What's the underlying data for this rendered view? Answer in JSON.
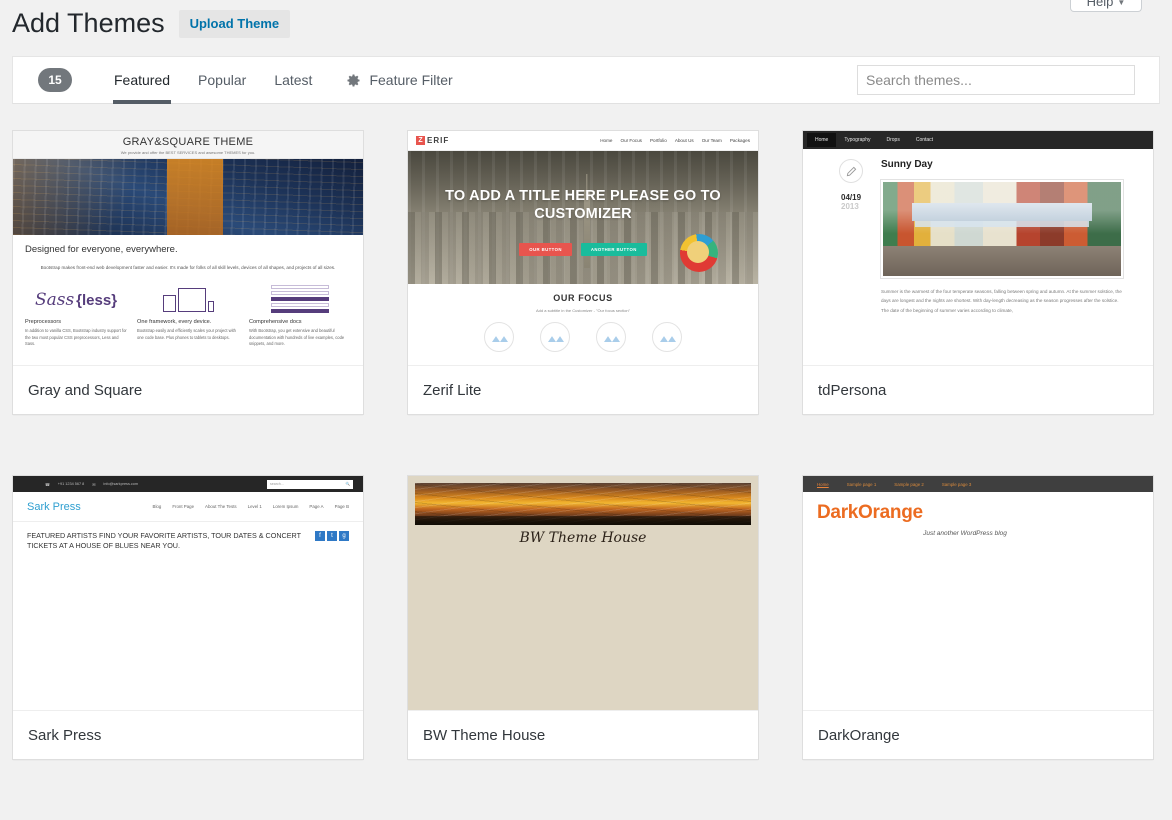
{
  "help_tab": {
    "label": "Help",
    "caret": "▼"
  },
  "header": {
    "title": "Add Themes",
    "upload_button": "Upload Theme"
  },
  "filter_bar": {
    "count": "15",
    "tabs": [
      {
        "label": "Featured",
        "active": true
      },
      {
        "label": "Popular",
        "active": false
      },
      {
        "label": "Latest",
        "active": false
      }
    ],
    "feature_filter": {
      "icon": "gear-icon",
      "label": "Feature Filter"
    },
    "search": {
      "placeholder": "Search themes...",
      "value": ""
    }
  },
  "themes": [
    {
      "name": "Gray and Square",
      "screenshot": {
        "site_title": "GRAY&SQUARE THEME",
        "site_tagline": "We provide and offer the BEST SERVICES and awesome THEMES for you.",
        "heading": "Designed for everyone, everywhere.",
        "lead": "Bootstrap makes front-end web development faster and easier. It's made for folks of all skill levels, devices of all shapes, and projects of all sizes.",
        "features": [
          {
            "art": "Sass {less}",
            "title": "Preprocessors",
            "text": "In addition to vanilla CSS, Bootstrap industry support for the two most popular CSS preprocessors, Less and Sass."
          },
          {
            "art": "devices",
            "title": "One framework, every device.",
            "text": "Bootstrap easily and efficiently scales your project with one code base. Plus phones to tablets to desktops."
          },
          {
            "art": "docs",
            "title": "Comprehensive docs",
            "text": "With Bootstrap, you get extensive and beautiful documentation with hundreds of live examples, code snippets, and more."
          }
        ]
      }
    },
    {
      "name": "Zerif Lite",
      "screenshot": {
        "logo_mark": "Z",
        "logo_word": "ERIF",
        "nav": [
          "Home",
          "Our Focus",
          "Portfolio",
          "About Us",
          "Our Team",
          "Packages"
        ],
        "hero_title": "TO ADD A TITLE HERE PLEASE GO TO CUSTOMIZER",
        "buttons": [
          {
            "label": "OUR BUTTON",
            "color": "#e8554e"
          },
          {
            "label": "ANOTHER BUTTON",
            "color": "#19bc9c"
          }
        ],
        "section_title": "OUR FOCUS",
        "section_sub": "Add a subtitle in the Customizer - \"Our focus section\""
      }
    },
    {
      "name": "tdPersona",
      "screenshot": {
        "nav": [
          "Home",
          "Typography",
          "Drops",
          "Contact"
        ],
        "active_nav": "Home",
        "icon": "pencil-icon",
        "date_day": "04/19",
        "date_year": "2013",
        "post_title": "Sunny Day",
        "post_text": "Summer is the warmest of the four temperate seasons, falling between spring and autumn. At the summer solstice, the days are longest and the nights are shortest. With day-length decreasing as the season progresses after the solstice. The date of the beginning of summer varies according to climate,"
      }
    },
    {
      "name": "Sark Press",
      "screenshot": {
        "phone": "+91 1234 567 8",
        "email": "info@sarkpress.com",
        "top_search_placeholder": "search...",
        "search_icon": "magnifier-icon",
        "logo": "Sark Press",
        "nav": [
          "Blog",
          "Front Page",
          "About The Tests",
          "Level 1",
          "Lorem Ipsum",
          "Page A",
          "Page B"
        ],
        "feature_text": "FEATURED ARTISTS FIND YOUR FAVORITE ARTISTS, TOUR DATES & CONCERT TICKETS AT A HOUSE OF BLUES NEAR YOU.",
        "social": [
          "f",
          "t",
          "g"
        ]
      }
    },
    {
      "name": "BW Theme House",
      "screenshot": {
        "banner": "sunset-banner",
        "site_title": "BW Theme House"
      }
    },
    {
      "name": "DarkOrange",
      "screenshot": {
        "nav": [
          "Home",
          "Sample page 1",
          "Sample page 2",
          "Sample page 3"
        ],
        "active_nav": "Home",
        "logo": "DarkOrange",
        "tagline": "Just another WordPress blog"
      }
    }
  ],
  "colors": {
    "page_background": "#f1f1f1",
    "card_background": "#ffffff",
    "link_blue": "#0073aa",
    "badge_gray": "#72777c",
    "text_dark": "#23282d",
    "text_muted": "#555d66"
  }
}
